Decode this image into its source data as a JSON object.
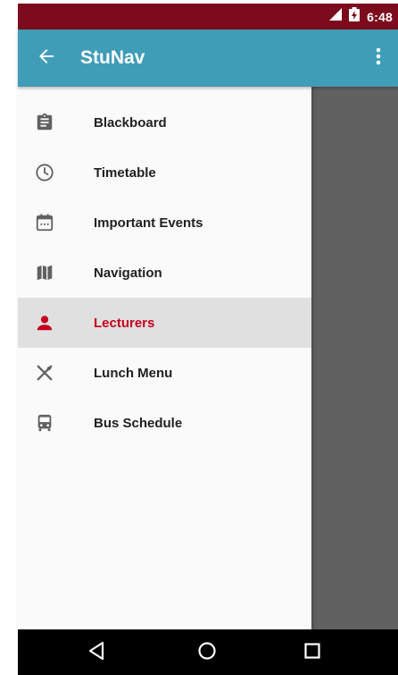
{
  "status_bar": {
    "time": "6:48",
    "icons": [
      "signal-icon",
      "battery-icon"
    ],
    "color": "#7b0b1d"
  },
  "app_bar": {
    "title": "StuNav",
    "color": "#3f9db8",
    "icons": [
      "arrow-back-icon",
      "more-vert-icon"
    ]
  },
  "drawer": {
    "items": [
      {
        "label": "Blackboard",
        "icon": "clipboard-icon",
        "active": false
      },
      {
        "label": "Timetable",
        "icon": "clock-icon",
        "active": false
      },
      {
        "label": "Important Events",
        "icon": "calendar-icon",
        "active": false
      },
      {
        "label": "Navigation",
        "icon": "map-icon",
        "active": false
      },
      {
        "label": "Lecturers",
        "icon": "person-icon",
        "active": true
      },
      {
        "label": "Lunch Menu",
        "icon": "utensils-icon",
        "active": false
      },
      {
        "label": "Bus Schedule",
        "icon": "bus-icon",
        "active": false
      }
    ],
    "active_color": "#c4001d",
    "active_background": "#e0e0e0"
  },
  "nav_bar": {
    "icons": [
      "back-triangle-icon",
      "home-circle-icon",
      "recents-square-icon"
    ]
  }
}
